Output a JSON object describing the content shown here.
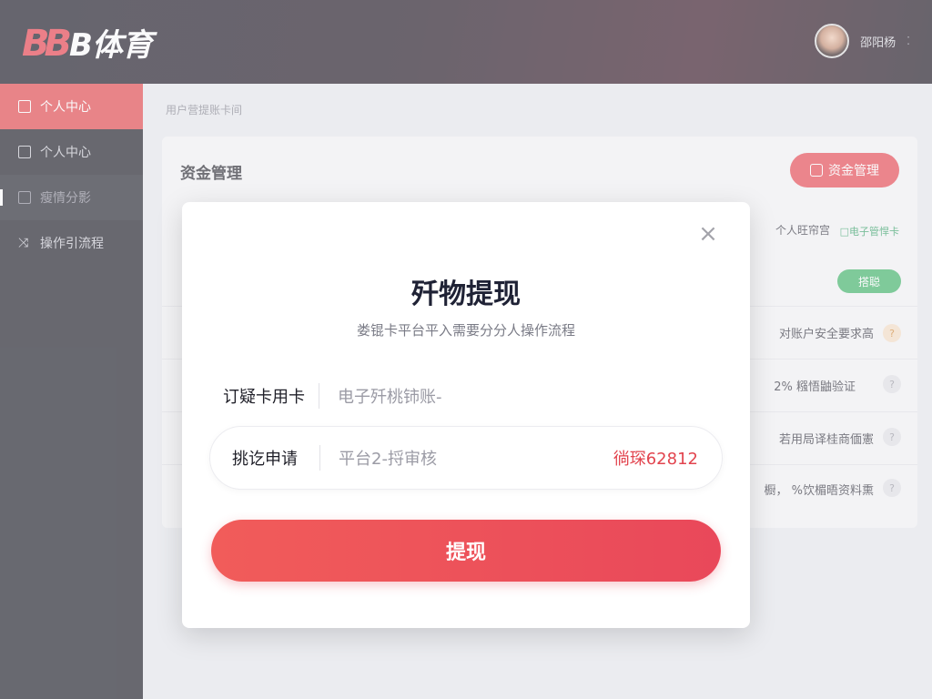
{
  "header": {
    "logo_text": "B体育",
    "username": "邵阳杨",
    "caret": "⁚"
  },
  "sidebar": {
    "items": [
      {
        "label": "个人中心",
        "state": "active"
      },
      {
        "label": "个人中心",
        "state": "normal"
      },
      {
        "label": "瘦情分影",
        "state": "dim"
      },
      {
        "label": "操作引流程",
        "state": "normal"
      }
    ]
  },
  "breadcrumb": "用户营提账卡间",
  "card": {
    "title": "资金管理",
    "button_label": "资金管理",
    "right_label": "个人旺帘宫",
    "right_tag": "□电子管悍卡",
    "green_button": "搭聪",
    "rows": [
      {
        "text": "对账户安全要求高",
        "q": "?"
      },
      {
        "text": "2% 糨悟鼬验证",
        "q": "?"
      },
      {
        "text": "若用局译桂商偭憲",
        "q": "?"
      },
      {
        "text": "橱， %饮楣晤资料熏",
        "q": "?"
      }
    ]
  },
  "modal": {
    "close": "×",
    "title": "歼物提现",
    "subtitle": "娄锟卡平台平入需要分分人操作流程",
    "fields": [
      {
        "label": "订疑卡用卡",
        "value": "电子歼桃铈账-"
      },
      {
        "label": "挑讫申请",
        "value": "平台2-捋审核",
        "extra": "徜琛62812"
      }
    ],
    "submit_label": "提现"
  },
  "colors": {
    "brand_red": "#e84c55",
    "sidebar_bg": "#1f2029",
    "success_green": "#43b56a"
  }
}
